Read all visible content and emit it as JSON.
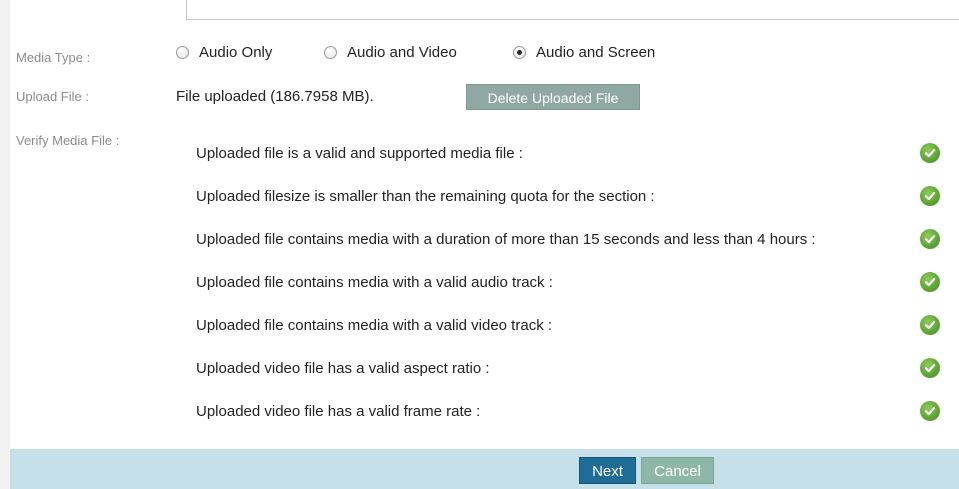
{
  "labels": {
    "media_type": "Media Type :",
    "upload_file": "Upload File :",
    "verify_media_file": "Verify Media File :"
  },
  "media_type": {
    "selected": "Audio and Screen",
    "options": [
      "Audio Only",
      "Audio and Video",
      "Audio and Screen"
    ]
  },
  "upload": {
    "status": "File uploaded (186.7958 MB).",
    "delete_label": "Delete Uploaded File"
  },
  "checks": [
    {
      "text": "Uploaded file is a valid and supported media file :",
      "passed": true
    },
    {
      "text": "Uploaded filesize is smaller than the remaining quota for the section :",
      "passed": true
    },
    {
      "text": "Uploaded file contains media with a duration of more than 15 seconds and less than 4 hours :",
      "passed": true
    },
    {
      "text": "Uploaded file contains media with a valid audio track :",
      "passed": true
    },
    {
      "text": "Uploaded file contains media with a valid video track :",
      "passed": true
    },
    {
      "text": "Uploaded video file has a valid aspect ratio :",
      "passed": true
    },
    {
      "text": "Uploaded video file has a valid frame rate :",
      "passed": true
    }
  ],
  "footer": {
    "next_label": "Next",
    "cancel_label": "Cancel"
  },
  "colors": {
    "check_green": "#5ea236",
    "footer_bg": "#c6e0ea",
    "next_bg": "#1f6c96",
    "cancel_bg": "#8fb7a8",
    "delete_bg": "#8fa8a3"
  },
  "icons": {
    "check": "check-circle-icon"
  }
}
